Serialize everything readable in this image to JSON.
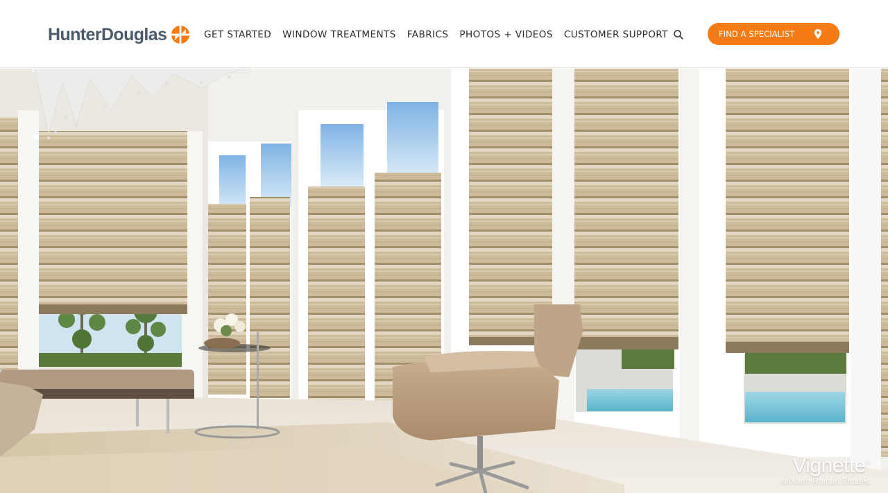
{
  "header": {
    "logo_text": "HunterDouglas",
    "logo_icon": "hunter-douglas-mark-icon",
    "nav": [
      {
        "label": "GET STARTED"
      },
      {
        "label": "WINDOW TREATMENTS"
      },
      {
        "label": "FABRICS"
      },
      {
        "label": "PHOTOS + VIDEOS"
      },
      {
        "label": "CUSTOMER SUPPORT"
      }
    ],
    "search_icon": "search-icon",
    "cta": {
      "label": "FIND A SPECIALIST",
      "icon": "map-pin-icon"
    }
  },
  "hero": {
    "product_name": "Vignette",
    "trademark": "®",
    "product_subtitle": "Modern Roman Shades"
  },
  "colors": {
    "brand_orange": "#f47b16",
    "logo_text": "#4a5a6a",
    "nav_text": "#2b2b2b",
    "shade_fabric": "#c8b79a",
    "wall": "#f2f0ec"
  }
}
